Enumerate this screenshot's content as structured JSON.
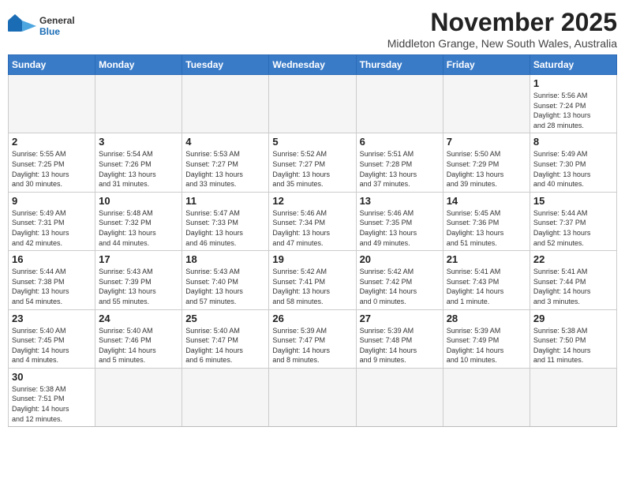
{
  "header": {
    "month_title": "November 2025",
    "subtitle": "Middleton Grange, New South Wales, Australia",
    "logo_general": "General",
    "logo_blue": "Blue"
  },
  "days_of_week": [
    "Sunday",
    "Monday",
    "Tuesday",
    "Wednesday",
    "Thursday",
    "Friday",
    "Saturday"
  ],
  "weeks": [
    [
      {
        "day": "",
        "info": ""
      },
      {
        "day": "",
        "info": ""
      },
      {
        "day": "",
        "info": ""
      },
      {
        "day": "",
        "info": ""
      },
      {
        "day": "",
        "info": ""
      },
      {
        "day": "",
        "info": ""
      },
      {
        "day": "1",
        "info": "Sunrise: 5:56 AM\nSunset: 7:24 PM\nDaylight: 13 hours\nand 28 minutes."
      }
    ],
    [
      {
        "day": "2",
        "info": "Sunrise: 5:55 AM\nSunset: 7:25 PM\nDaylight: 13 hours\nand 30 minutes."
      },
      {
        "day": "3",
        "info": "Sunrise: 5:54 AM\nSunset: 7:26 PM\nDaylight: 13 hours\nand 31 minutes."
      },
      {
        "day": "4",
        "info": "Sunrise: 5:53 AM\nSunset: 7:27 PM\nDaylight: 13 hours\nand 33 minutes."
      },
      {
        "day": "5",
        "info": "Sunrise: 5:52 AM\nSunset: 7:27 PM\nDaylight: 13 hours\nand 35 minutes."
      },
      {
        "day": "6",
        "info": "Sunrise: 5:51 AM\nSunset: 7:28 PM\nDaylight: 13 hours\nand 37 minutes."
      },
      {
        "day": "7",
        "info": "Sunrise: 5:50 AM\nSunset: 7:29 PM\nDaylight: 13 hours\nand 39 minutes."
      },
      {
        "day": "8",
        "info": "Sunrise: 5:49 AM\nSunset: 7:30 PM\nDaylight: 13 hours\nand 40 minutes."
      }
    ],
    [
      {
        "day": "9",
        "info": "Sunrise: 5:49 AM\nSunset: 7:31 PM\nDaylight: 13 hours\nand 42 minutes."
      },
      {
        "day": "10",
        "info": "Sunrise: 5:48 AM\nSunset: 7:32 PM\nDaylight: 13 hours\nand 44 minutes."
      },
      {
        "day": "11",
        "info": "Sunrise: 5:47 AM\nSunset: 7:33 PM\nDaylight: 13 hours\nand 46 minutes."
      },
      {
        "day": "12",
        "info": "Sunrise: 5:46 AM\nSunset: 7:34 PM\nDaylight: 13 hours\nand 47 minutes."
      },
      {
        "day": "13",
        "info": "Sunrise: 5:46 AM\nSunset: 7:35 PM\nDaylight: 13 hours\nand 49 minutes."
      },
      {
        "day": "14",
        "info": "Sunrise: 5:45 AM\nSunset: 7:36 PM\nDaylight: 13 hours\nand 51 minutes."
      },
      {
        "day": "15",
        "info": "Sunrise: 5:44 AM\nSunset: 7:37 PM\nDaylight: 13 hours\nand 52 minutes."
      }
    ],
    [
      {
        "day": "16",
        "info": "Sunrise: 5:44 AM\nSunset: 7:38 PM\nDaylight: 13 hours\nand 54 minutes."
      },
      {
        "day": "17",
        "info": "Sunrise: 5:43 AM\nSunset: 7:39 PM\nDaylight: 13 hours\nand 55 minutes."
      },
      {
        "day": "18",
        "info": "Sunrise: 5:43 AM\nSunset: 7:40 PM\nDaylight: 13 hours\nand 57 minutes."
      },
      {
        "day": "19",
        "info": "Sunrise: 5:42 AM\nSunset: 7:41 PM\nDaylight: 13 hours\nand 58 minutes."
      },
      {
        "day": "20",
        "info": "Sunrise: 5:42 AM\nSunset: 7:42 PM\nDaylight: 14 hours\nand 0 minutes."
      },
      {
        "day": "21",
        "info": "Sunrise: 5:41 AM\nSunset: 7:43 PM\nDaylight: 14 hours\nand 1 minute."
      },
      {
        "day": "22",
        "info": "Sunrise: 5:41 AM\nSunset: 7:44 PM\nDaylight: 14 hours\nand 3 minutes."
      }
    ],
    [
      {
        "day": "23",
        "info": "Sunrise: 5:40 AM\nSunset: 7:45 PM\nDaylight: 14 hours\nand 4 minutes."
      },
      {
        "day": "24",
        "info": "Sunrise: 5:40 AM\nSunset: 7:46 PM\nDaylight: 14 hours\nand 5 minutes."
      },
      {
        "day": "25",
        "info": "Sunrise: 5:40 AM\nSunset: 7:47 PM\nDaylight: 14 hours\nand 6 minutes."
      },
      {
        "day": "26",
        "info": "Sunrise: 5:39 AM\nSunset: 7:47 PM\nDaylight: 14 hours\nand 8 minutes."
      },
      {
        "day": "27",
        "info": "Sunrise: 5:39 AM\nSunset: 7:48 PM\nDaylight: 14 hours\nand 9 minutes."
      },
      {
        "day": "28",
        "info": "Sunrise: 5:39 AM\nSunset: 7:49 PM\nDaylight: 14 hours\nand 10 minutes."
      },
      {
        "day": "29",
        "info": "Sunrise: 5:38 AM\nSunset: 7:50 PM\nDaylight: 14 hours\nand 11 minutes."
      }
    ],
    [
      {
        "day": "30",
        "info": "Sunrise: 5:38 AM\nSunset: 7:51 PM\nDaylight: 14 hours\nand 12 minutes."
      },
      {
        "day": "",
        "info": ""
      },
      {
        "day": "",
        "info": ""
      },
      {
        "day": "",
        "info": ""
      },
      {
        "day": "",
        "info": ""
      },
      {
        "day": "",
        "info": ""
      },
      {
        "day": "",
        "info": ""
      }
    ]
  ]
}
